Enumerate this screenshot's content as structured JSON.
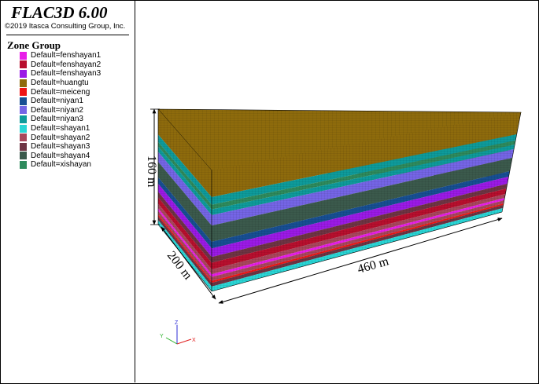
{
  "app": {
    "title": "FLAC3D 6.00",
    "copyright": "©2019 Itasca Consulting Group, Inc."
  },
  "legend": {
    "title": "Zone Group",
    "items": [
      {
        "label": "Default=fenshayan1",
        "color": "#e81ee8"
      },
      {
        "label": "Default=fenshayan2",
        "color": "#b80f2e"
      },
      {
        "label": "Default=fenshayan3",
        "color": "#9b1ae6"
      },
      {
        "label": "Default=huangtu",
        "color": "#8e6b0c"
      },
      {
        "label": "Default=meiceng",
        "color": "#ee1414"
      },
      {
        "label": "Default=niyan1",
        "color": "#174f93"
      },
      {
        "label": "Default=niyan2",
        "color": "#7565e6"
      },
      {
        "label": "Default=niyan3",
        "color": "#0e9b9b"
      },
      {
        "label": "Default=shayan1",
        "color": "#29d6d6"
      },
      {
        "label": "Default=shayan2",
        "color": "#a8475b"
      },
      {
        "label": "Default=shayan3",
        "color": "#6e3443"
      },
      {
        "label": "Default=shayan4",
        "color": "#3b5a4c"
      },
      {
        "label": "Default=xishayan",
        "color": "#2e8b5d"
      }
    ]
  },
  "model": {
    "height_label": "160 m",
    "depth_label": "200 m",
    "length_label": "460 m",
    "axes": {
      "x": "X",
      "y": "Y",
      "z": "Z"
    },
    "layers_top_to_bottom": [
      {
        "group": "huangtu",
        "color": "#8e6b0c",
        "thickness": 28
      },
      {
        "group": "niyan3",
        "color": "#0e9b9b",
        "thickness": 8
      },
      {
        "group": "xishayan",
        "color": "#2e8b5d",
        "thickness": 5
      },
      {
        "group": "niyan3",
        "color": "#0e9b9b",
        "thickness": 6
      },
      {
        "group": "niyan2",
        "color": "#7565e6",
        "thickness": 11
      },
      {
        "group": "shayan4",
        "color": "#3b5a4c",
        "thickness": 17
      },
      {
        "group": "niyan1",
        "color": "#174f93",
        "thickness": 7
      },
      {
        "group": "fenshayan3",
        "color": "#9b1ae6",
        "thickness": 9
      },
      {
        "group": "shayan3",
        "color": "#6e3443",
        "thickness": 6
      },
      {
        "group": "fenshayan2",
        "color": "#b80f2e",
        "thickness": 7
      },
      {
        "group": "shayan2",
        "color": "#a8475b",
        "thickness": 5
      },
      {
        "group": "fenshayan1",
        "color": "#e81ee8",
        "thickness": 3
      },
      {
        "group": "shayan2",
        "color": "#a8475b",
        "thickness": 4
      },
      {
        "group": "meiceng",
        "color": "#ee1414",
        "thickness": 2
      },
      {
        "group": "shayan3",
        "color": "#6e3443",
        "thickness": 4
      },
      {
        "group": "shayan1",
        "color": "#29d6d6",
        "thickness": 5
      }
    ]
  }
}
